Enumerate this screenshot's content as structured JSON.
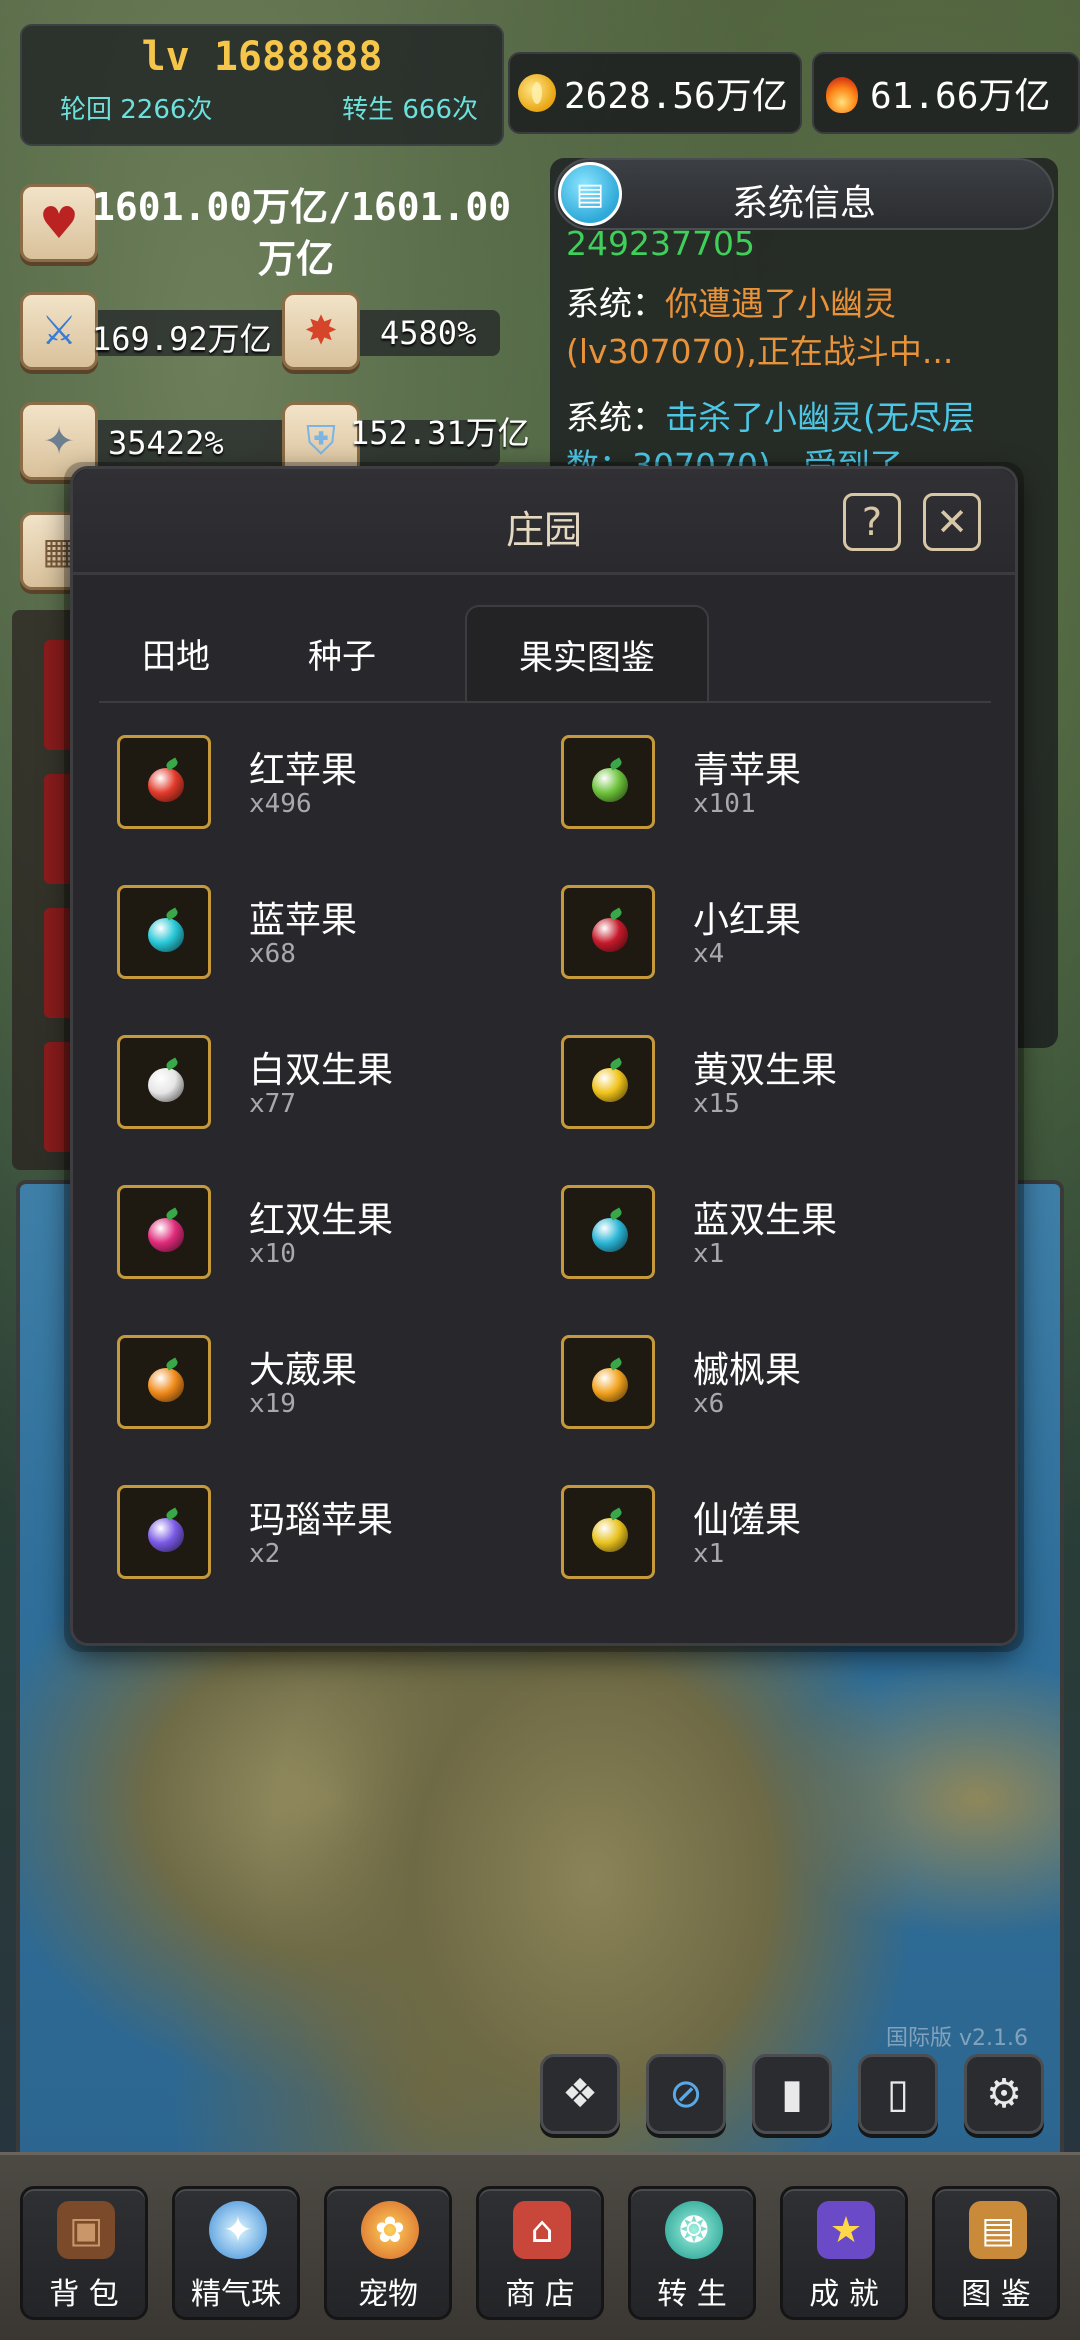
{
  "hud": {
    "level": "lv 1688888",
    "reincarnation": "轮回 2266次",
    "rebirth": "转生 666次",
    "gold": "2628.56万亿",
    "fire": "61.66万亿"
  },
  "stats": {
    "hp_line1": "1601.00万亿/1601.00",
    "hp_line2": "万亿",
    "attack": "169.92万亿",
    "crit": "4580%",
    "crit_damage": "35422%",
    "defense": "152.31万亿"
  },
  "system_info": {
    "title": "系统信息",
    "cut_line": "249237705",
    "messages": [
      {
        "label": "系统：",
        "text": "你遭遇了小幽灵(lv307070),正在战斗中..."
      },
      {
        "label": "系统：",
        "text": "击杀了小幽灵(无尽层数：307070)，受到了..."
      }
    ]
  },
  "modal": {
    "title": "庄园",
    "tabs": [
      "田地",
      "种子",
      "果实图鉴"
    ],
    "active_tab": "果实图鉴",
    "fruits": [
      {
        "name": "红苹果",
        "count": "x496",
        "icon": "red-apple-icon",
        "color": "#e23a2a"
      },
      {
        "name": "青苹果",
        "count": "x101",
        "icon": "green-apple-icon",
        "color": "#6cc23a"
      },
      {
        "name": "蓝苹果",
        "count": "x68",
        "icon": "blue-apple-icon",
        "color": "#26c7d6"
      },
      {
        "name": "小红果",
        "count": "x4",
        "icon": "small-red-fruit-icon",
        "color": "#c51a2a"
      },
      {
        "name": "白双生果",
        "count": "x77",
        "icon": "white-twin-fruit-icon",
        "color": "#e6e6e6"
      },
      {
        "name": "黄双生果",
        "count": "x15",
        "icon": "yellow-twin-fruit-icon",
        "color": "#f0c21a"
      },
      {
        "name": "红双生果",
        "count": "x10",
        "icon": "red-twin-fruit-icon",
        "color": "#e02a7a"
      },
      {
        "name": "蓝双生果",
        "count": "x1",
        "icon": "blue-twin-fruit-icon",
        "color": "#2ab5d6"
      },
      {
        "name": "大葳果",
        "count": "x19",
        "icon": "big-orange-fruit-icon",
        "color": "#f08a1a"
      },
      {
        "name": "槭枫果",
        "count": "x6",
        "icon": "maple-fruit-icon",
        "color": "#f2a21e"
      },
      {
        "name": "玛瑙苹果",
        "count": "x2",
        "icon": "agate-apple-icon",
        "color": "#7a5ae6"
      },
      {
        "name": "仙馐果",
        "count": "x1",
        "icon": "immortal-fruit-icon",
        "color": "#e8c21e"
      }
    ]
  },
  "version": "国际版 v2.1.6",
  "bottom_nav": [
    {
      "label": "背 包",
      "icon": "backpack-icon"
    },
    {
      "label": "精气珠",
      "icon": "spirit-orb-icon"
    },
    {
      "label": "宠物",
      "icon": "pet-icon"
    },
    {
      "label": "商 店",
      "icon": "shop-icon"
    },
    {
      "label": "转 生",
      "icon": "rebirth-icon"
    },
    {
      "label": "成 就",
      "icon": "achievement-icon"
    },
    {
      "label": "图 鉴",
      "icon": "codex-icon"
    }
  ],
  "map_buttons": [
    "treasure-icon",
    "mute-icon",
    "ranking-icon",
    "book-icon",
    "settings-icon"
  ]
}
